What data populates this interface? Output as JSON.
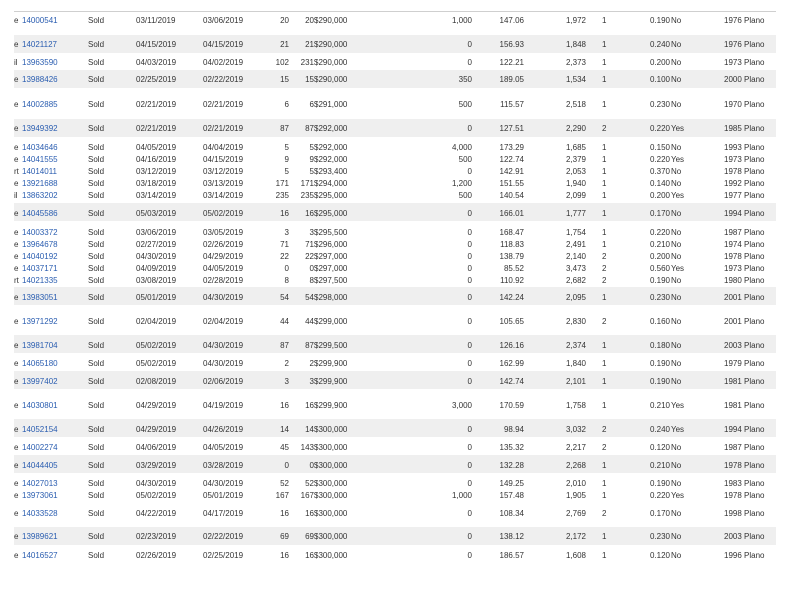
{
  "rows": [
    {
      "pre": "e",
      "mls": "14000541",
      "status": "Sold",
      "close": "03/11/2019",
      "list": "03/06/2019",
      "dom": "20",
      "cdom": "20",
      "price": "$290,000",
      "sqft": "1,000",
      "ppsf": "147.06",
      "lsqft": "1,972",
      "gar": "1",
      "acres": "0.190",
      "pool": "No",
      "year": "1976",
      "city": "Plano",
      "shade": false
    },
    {
      "pre": "e",
      "mls": "14021127",
      "status": "Sold",
      "close": "04/15/2019",
      "list": "04/15/2019",
      "dom": "21",
      "cdom": "21",
      "price": "$290,000",
      "sqft": "0",
      "ppsf": "156.93",
      "lsqft": "1,848",
      "gar": "1",
      "acres": "0.240",
      "pool": "No",
      "year": "1976",
      "city": "Plano",
      "shade": true
    },
    {
      "pre": "il",
      "mls": "13963590",
      "status": "Sold",
      "close": "04/03/2019",
      "list": "04/02/2019",
      "dom": "102",
      "cdom": "231",
      "price": "$290,000",
      "sqft": "0",
      "ppsf": "122.21",
      "lsqft": "2,373",
      "gar": "1",
      "acres": "0.200",
      "pool": "No",
      "year": "1973",
      "city": "Plano",
      "shade": false
    },
    {
      "pre": "e",
      "mls": "13988426",
      "status": "Sold",
      "close": "02/25/2019",
      "list": "02/22/2019",
      "dom": "15",
      "cdom": "15",
      "price": "$290,000",
      "sqft": "350",
      "ppsf": "189.05",
      "lsqft": "1,534",
      "gar": "1",
      "acres": "0.100",
      "pool": "No",
      "year": "2000",
      "city": "Plano",
      "shade": true
    },
    {
      "pre": "e",
      "mls": "14002885",
      "status": "Sold",
      "close": "02/21/2019",
      "list": "02/21/2019",
      "dom": "6",
      "cdom": "6",
      "price": "$291,000",
      "sqft": "500",
      "ppsf": "115.57",
      "lsqft": "2,518",
      "gar": "1",
      "acres": "0.230",
      "pool": "No",
      "year": "1970",
      "city": "Plano",
      "shade": false
    },
    {
      "pre": "e",
      "mls": "13949392",
      "status": "Sold",
      "close": "02/21/2019",
      "list": "02/21/2019",
      "dom": "87",
      "cdom": "87",
      "price": "$292,000",
      "sqft": "0",
      "ppsf": "127.51",
      "lsqft": "2,290",
      "gar": "2",
      "acres": "0.220",
      "pool": "Yes",
      "year": "1985",
      "city": "Plano",
      "shade": true
    },
    {
      "pre": "e",
      "mls": "14034646",
      "status": "Sold",
      "close": "04/05/2019",
      "list": "04/04/2019",
      "dom": "5",
      "cdom": "5",
      "price": "$292,000",
      "sqft": "4,000",
      "ppsf": "173.29",
      "lsqft": "1,685",
      "gar": "1",
      "acres": "0.150",
      "pool": "No",
      "year": "1993",
      "city": "Plano",
      "shade": false
    },
    {
      "pre": "e",
      "mls": "14041555",
      "status": "Sold",
      "close": "04/16/2019",
      "list": "04/15/2019",
      "dom": "9",
      "cdom": "9",
      "price": "$292,000",
      "sqft": "500",
      "ppsf": "122.74",
      "lsqft": "2,379",
      "gar": "1",
      "acres": "0.220",
      "pool": "Yes",
      "year": "1973",
      "city": "Plano",
      "shade": false
    },
    {
      "pre": "rt",
      "mls": "14014011",
      "status": "Sold",
      "close": "03/12/2019",
      "list": "03/12/2019",
      "dom": "5",
      "cdom": "5",
      "price": "$293,400",
      "sqft": "0",
      "ppsf": "142.91",
      "lsqft": "2,053",
      "gar": "1",
      "acres": "0.370",
      "pool": "No",
      "year": "1978",
      "city": "Plano",
      "shade": false
    },
    {
      "pre": "e",
      "mls": "13921688",
      "status": "Sold",
      "close": "03/18/2019",
      "list": "03/13/2019",
      "dom": "171",
      "cdom": "171",
      "price": "$294,000",
      "sqft": "1,200",
      "ppsf": "151.55",
      "lsqft": "1,940",
      "gar": "1",
      "acres": "0.140",
      "pool": "No",
      "year": "1992",
      "city": "Plano",
      "shade": false
    },
    {
      "pre": "il",
      "mls": "13863202",
      "status": "Sold",
      "close": "03/14/2019",
      "list": "03/14/2019",
      "dom": "235",
      "cdom": "235",
      "price": "$295,000",
      "sqft": "500",
      "ppsf": "140.54",
      "lsqft": "2,099",
      "gar": "1",
      "acres": "0.200",
      "pool": "Yes",
      "year": "1977",
      "city": "Plano",
      "shade": false
    },
    {
      "pre": "e",
      "mls": "14045586",
      "status": "Sold",
      "close": "05/03/2019",
      "list": "05/02/2019",
      "dom": "16",
      "cdom": "16",
      "price": "$295,000",
      "sqft": "0",
      "ppsf": "166.01",
      "lsqft": "1,777",
      "gar": "1",
      "acres": "0.170",
      "pool": "No",
      "year": "1994",
      "city": "Plano",
      "shade": true
    },
    {
      "pre": "e",
      "mls": "14003372",
      "status": "Sold",
      "close": "03/06/2019",
      "list": "03/05/2019",
      "dom": "3",
      "cdom": "3",
      "price": "$295,500",
      "sqft": "0",
      "ppsf": "168.47",
      "lsqft": "1,754",
      "gar": "1",
      "acres": "0.220",
      "pool": "No",
      "year": "1987",
      "city": "Plano",
      "shade": false
    },
    {
      "pre": "e",
      "mls": "13964678",
      "status": "Sold",
      "close": "02/27/2019",
      "list": "02/26/2019",
      "dom": "71",
      "cdom": "71",
      "price": "$296,000",
      "sqft": "0",
      "ppsf": "118.83",
      "lsqft": "2,491",
      "gar": "1",
      "acres": "0.210",
      "pool": "No",
      "year": "1974",
      "city": "Plano",
      "shade": false
    },
    {
      "pre": "e",
      "mls": "14040192",
      "status": "Sold",
      "close": "04/30/2019",
      "list": "04/29/2019",
      "dom": "22",
      "cdom": "22",
      "price": "$297,000",
      "sqft": "0",
      "ppsf": "138.79",
      "lsqft": "2,140",
      "gar": "2",
      "acres": "0.200",
      "pool": "No",
      "year": "1978",
      "city": "Plano",
      "shade": false
    },
    {
      "pre": "e",
      "mls": "14037171",
      "status": "Sold",
      "close": "04/09/2019",
      "list": "04/05/2019",
      "dom": "0",
      "cdom": "0",
      "price": "$297,000",
      "sqft": "0",
      "ppsf": "85.52",
      "lsqft": "3,473",
      "gar": "2",
      "acres": "0.560",
      "pool": "Yes",
      "year": "1973",
      "city": "Plano",
      "shade": false
    },
    {
      "pre": "rt",
      "mls": "14021335",
      "status": "Sold",
      "close": "03/08/2019",
      "list": "02/28/2019",
      "dom": "8",
      "cdom": "8",
      "price": "$297,500",
      "sqft": "0",
      "ppsf": "110.92",
      "lsqft": "2,682",
      "gar": "2",
      "acres": "0.190",
      "pool": "No",
      "year": "1980",
      "city": "Plano",
      "shade": false
    },
    {
      "pre": "e",
      "mls": "13983051",
      "status": "Sold",
      "close": "05/01/2019",
      "list": "04/30/2019",
      "dom": "54",
      "cdom": "54",
      "price": "$298,000",
      "sqft": "0",
      "ppsf": "142.24",
      "lsqft": "2,095",
      "gar": "1",
      "acres": "0.230",
      "pool": "No",
      "year": "2001",
      "city": "Plano",
      "shade": true
    },
    {
      "pre": "e",
      "mls": "13971292",
      "status": "Sold",
      "close": "02/04/2019",
      "list": "02/04/2019",
      "dom": "44",
      "cdom": "44",
      "price": "$299,000",
      "sqft": "0",
      "ppsf": "105.65",
      "lsqft": "2,830",
      "gar": "2",
      "acres": "0.160",
      "pool": "No",
      "year": "2001",
      "city": "Plano",
      "shade": false
    },
    {
      "pre": "e",
      "mls": "13981704",
      "status": "Sold",
      "close": "05/02/2019",
      "list": "04/30/2019",
      "dom": "87",
      "cdom": "87",
      "price": "$299,500",
      "sqft": "0",
      "ppsf": "126.16",
      "lsqft": "2,374",
      "gar": "1",
      "acres": "0.180",
      "pool": "No",
      "year": "2003",
      "city": "Plano",
      "shade": true
    },
    {
      "pre": "e",
      "mls": "14065180",
      "status": "Sold",
      "close": "05/02/2019",
      "list": "04/30/2019",
      "dom": "2",
      "cdom": "2",
      "price": "$299,900",
      "sqft": "0",
      "ppsf": "162.99",
      "lsqft": "1,840",
      "gar": "1",
      "acres": "0.190",
      "pool": "No",
      "year": "1979",
      "city": "Plano",
      "shade": false
    },
    {
      "pre": "e",
      "mls": "13997402",
      "status": "Sold",
      "close": "02/08/2019",
      "list": "02/06/2019",
      "dom": "3",
      "cdom": "3",
      "price": "$299,900",
      "sqft": "0",
      "ppsf": "142.74",
      "lsqft": "2,101",
      "gar": "1",
      "acres": "0.190",
      "pool": "No",
      "year": "1981",
      "city": "Plano",
      "shade": true
    },
    {
      "pre": "e",
      "mls": "14030801",
      "status": "Sold",
      "close": "04/29/2019",
      "list": "04/19/2019",
      "dom": "16",
      "cdom": "16",
      "price": "$299,900",
      "sqft": "3,000",
      "ppsf": "170.59",
      "lsqft": "1,758",
      "gar": "1",
      "acres": "0.210",
      "pool": "Yes",
      "year": "1981",
      "city": "Plano",
      "shade": false
    },
    {
      "pre": "e",
      "mls": "14052154",
      "status": "Sold",
      "close": "04/29/2019",
      "list": "04/26/2019",
      "dom": "14",
      "cdom": "14",
      "price": "$300,000",
      "sqft": "0",
      "ppsf": "98.94",
      "lsqft": "3,032",
      "gar": "2",
      "acres": "0.240",
      "pool": "Yes",
      "year": "1994",
      "city": "Plano",
      "shade": true
    },
    {
      "pre": "e",
      "mls": "14002274",
      "status": "Sold",
      "close": "04/06/2019",
      "list": "04/05/2019",
      "dom": "45",
      "cdom": "143",
      "price": "$300,000",
      "sqft": "0",
      "ppsf": "135.32",
      "lsqft": "2,217",
      "gar": "2",
      "acres": "0.120",
      "pool": "No",
      "year": "1987",
      "city": "Plano",
      "shade": false
    },
    {
      "pre": "e",
      "mls": "14044405",
      "status": "Sold",
      "close": "03/29/2019",
      "list": "03/28/2019",
      "dom": "0",
      "cdom": "0",
      "price": "$300,000",
      "sqft": "0",
      "ppsf": "132.28",
      "lsqft": "2,268",
      "gar": "1",
      "acres": "0.210",
      "pool": "No",
      "year": "1978",
      "city": "Plano",
      "shade": true
    },
    {
      "pre": "e",
      "mls": "14027013",
      "status": "Sold",
      "close": "04/30/2019",
      "list": "04/30/2019",
      "dom": "52",
      "cdom": "52",
      "price": "$300,000",
      "sqft": "0",
      "ppsf": "149.25",
      "lsqft": "2,010",
      "gar": "1",
      "acres": "0.190",
      "pool": "No",
      "year": "1983",
      "city": "Plano",
      "shade": false
    },
    {
      "pre": "e",
      "mls": "13973061",
      "status": "Sold",
      "close": "05/02/2019",
      "list": "05/01/2019",
      "dom": "167",
      "cdom": "167",
      "price": "$300,000",
      "sqft": "1,000",
      "ppsf": "157.48",
      "lsqft": "1,905",
      "gar": "1",
      "acres": "0.220",
      "pool": "Yes",
      "year": "1978",
      "city": "Plano",
      "shade": false
    },
    {
      "pre": "e",
      "mls": "14033528",
      "status": "Sold",
      "close": "04/22/2019",
      "list": "04/17/2019",
      "dom": "16",
      "cdom": "16",
      "price": "$300,000",
      "sqft": "0",
      "ppsf": "108.34",
      "lsqft": "2,769",
      "gar": "2",
      "acres": "0.170",
      "pool": "No",
      "year": "1998",
      "city": "Plano",
      "shade": false
    },
    {
      "pre": "e",
      "mls": "13989621",
      "status": "Sold",
      "close": "02/23/2019",
      "list": "02/22/2019",
      "dom": "69",
      "cdom": "69",
      "price": "$300,000",
      "sqft": "0",
      "ppsf": "138.12",
      "lsqft": "2,172",
      "gar": "1",
      "acres": "0.230",
      "pool": "No",
      "year": "2003",
      "city": "Plano",
      "shade": true
    },
    {
      "pre": "e",
      "mls": "14016527",
      "status": "Sold",
      "close": "02/26/2019",
      "list": "02/25/2019",
      "dom": "16",
      "cdom": "16",
      "price": "$300,000",
      "sqft": "0",
      "ppsf": "186.57",
      "lsqft": "1,608",
      "gar": "1",
      "acres": "0.120",
      "pool": "No",
      "year": "1996",
      "city": "Plano",
      "shade": false
    }
  ]
}
